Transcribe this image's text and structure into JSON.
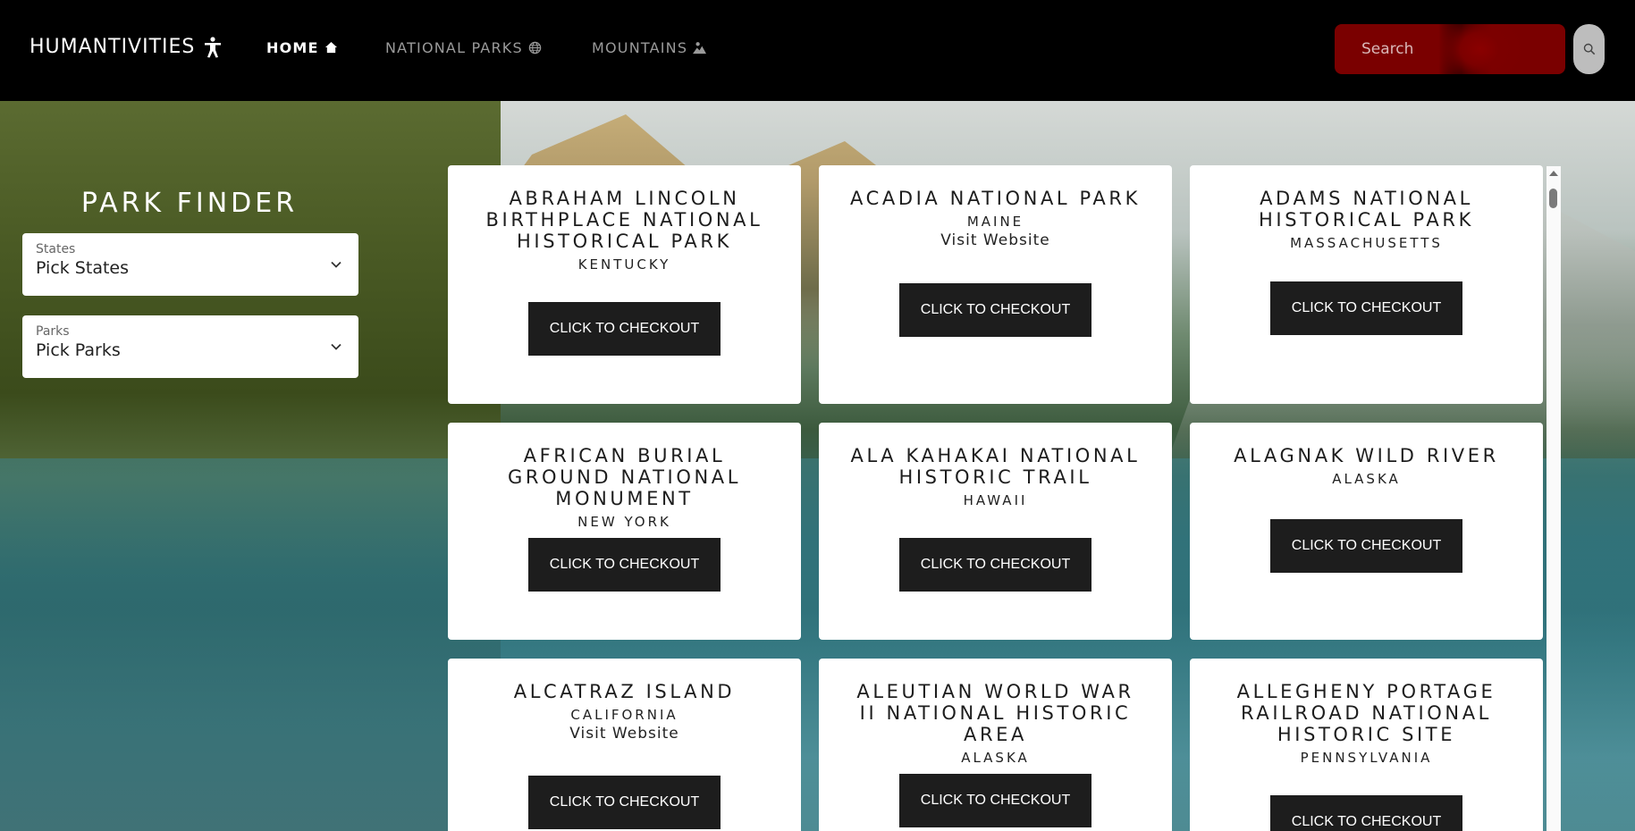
{
  "nav": {
    "brand": "HUMANTIVITIES",
    "links": [
      {
        "label": "HOME",
        "icon": "home-icon"
      },
      {
        "label": "NATIONAL PARKS",
        "icon": "globe-icon"
      },
      {
        "label": "MOUNTAINS",
        "icon": "mountain-icon"
      }
    ],
    "search_placeholder": "Search"
  },
  "finder": {
    "title": "PARK FINDER",
    "states": {
      "label": "States",
      "value": "Pick States"
    },
    "parks": {
      "label": "Parks",
      "value": "Pick Parks"
    }
  },
  "parks": [
    {
      "name": "ABRAHAM LINCOLN BIRTHPLACE NATIONAL HISTORICAL PARK",
      "state": "KENTUCKY",
      "link": "",
      "button": "CLICK TO CHECKOUT"
    },
    {
      "name": "ACADIA NATIONAL PARK",
      "state": "MAINE",
      "link": "Visit Website",
      "button": "CLICK TO CHECKOUT"
    },
    {
      "name": "ADAMS NATIONAL HISTORICAL PARK",
      "state": "MASSACHUSETTS",
      "link": "",
      "button": "CLICK TO CHECKOUT"
    },
    {
      "name": "AFRICAN BURIAL GROUND NATIONAL MONUMENT",
      "state": "NEW YORK",
      "link": "",
      "button": "CLICK TO CHECKOUT"
    },
    {
      "name": "ALA KAHAKAI NATIONAL HISTORIC TRAIL",
      "state": "HAWAII",
      "link": "",
      "button": "CLICK TO CHECKOUT"
    },
    {
      "name": "ALAGNAK WILD RIVER",
      "state": "ALASKA",
      "link": "",
      "button": "CLICK TO CHECKOUT"
    },
    {
      "name": "ALCATRAZ ISLAND",
      "state": "CALIFORNIA",
      "link": "Visit Website",
      "button": "CLICK TO CHECKOUT"
    },
    {
      "name": "ALEUTIAN WORLD WAR II NATIONAL HISTORIC AREA",
      "state": "ALASKA",
      "link": "",
      "button": "CLICK TO CHECKOUT"
    },
    {
      "name": "ALLEGHENY PORTAGE RAILROAD NATIONAL HISTORIC SITE",
      "state": "PENNSYLVANIA",
      "link": "",
      "button": "CLICK TO CHECKOUT"
    }
  ],
  "colors": {
    "navbar": "#000000",
    "search": "#7a0000",
    "button": "#1d1d1d"
  }
}
